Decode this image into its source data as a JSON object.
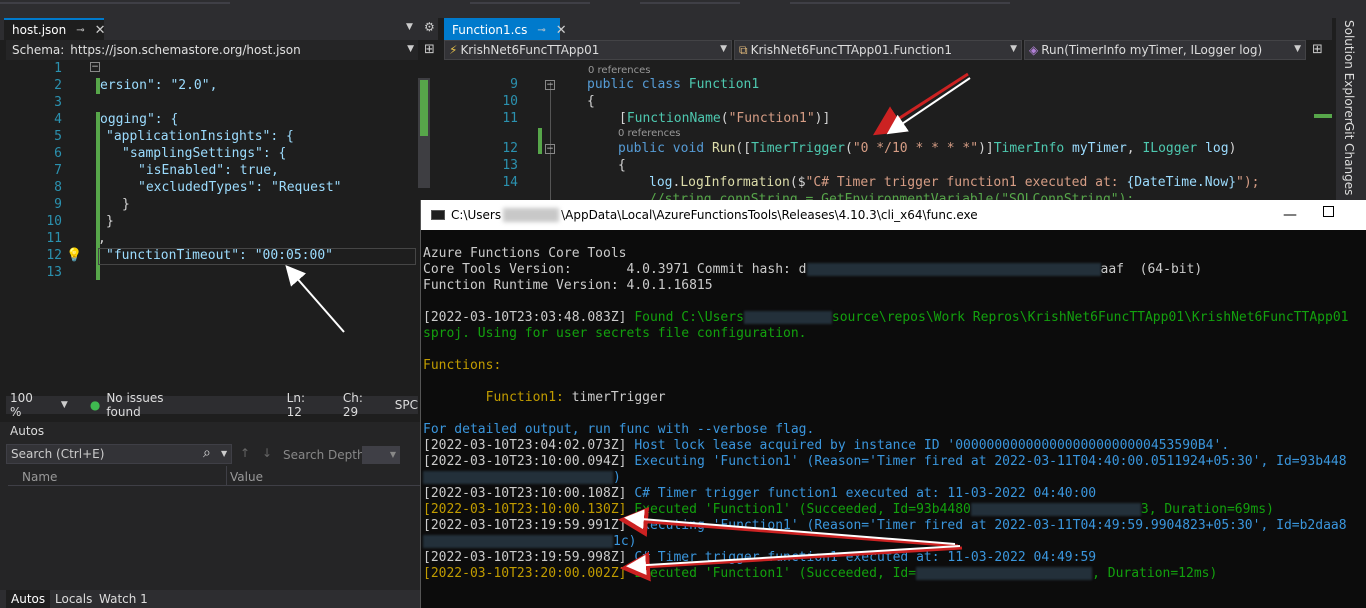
{
  "left_editor": {
    "tab_title": "host.json",
    "schema_label": "Schema:",
    "schema_url": "https://json.schemastore.org/host.json",
    "lines": [
      {
        "n": "1",
        "text": ""
      },
      {
        "n": "2",
        "text": "ersion\": \"2.0\","
      },
      {
        "n": "3",
        "text": ""
      },
      {
        "n": "4",
        "text": "ogging\": {"
      },
      {
        "n": "5",
        "text": "\"applicationInsights\": {"
      },
      {
        "n": "6",
        "text": "\"samplingSettings\": {"
      },
      {
        "n": "7",
        "text": "\"isEnabled\": true,"
      },
      {
        "n": "8",
        "text": "\"excludedTypes\": \"Request\""
      },
      {
        "n": "9",
        "text": "}"
      },
      {
        "n": "10",
        "text": "}"
      },
      {
        "n": "11",
        "text": ","
      },
      {
        "n": "12",
        "text": "\"functionTimeout\": \"00:05:00\""
      },
      {
        "n": "13",
        "text": ""
      }
    ],
    "status": {
      "zoom": "100 %",
      "issues": "No issues found",
      "ln": "Ln: 12",
      "ch": "Ch: 29",
      "enc": "SPC"
    }
  },
  "autos": {
    "title": "Autos",
    "search_placeholder": "Search (Ctrl+E)",
    "search_depth": "Search Depth:",
    "col_name": "Name",
    "col_value": "Value",
    "tabs": [
      "Autos",
      "Locals",
      "Watch 1"
    ]
  },
  "right_editor": {
    "tab_title": "Function1.cs",
    "nav": [
      "KrishNet6FuncTTApp01",
      "KrishNet6FuncTTApp01.Function1",
      "Run(TimerInfo myTimer, ILogger log)"
    ],
    "refs1": "0 references",
    "refs2": "0 references",
    "line_numbers": [
      "9",
      "10",
      "11",
      "12",
      "13",
      "14"
    ],
    "l9": {
      "kw1": "public",
      "kw2": "class",
      "name": "Function1"
    },
    "l10": "{",
    "l11": {
      "pre": "[",
      "attr": "FunctionName",
      "open": "(",
      "str": "\"Function1\"",
      "close": ")]"
    },
    "l12": {
      "kw1": "public",
      "kw2": "void",
      "meth": "Run",
      "p1": "([",
      "attr": "TimerTrigger",
      "p2": "(",
      "str": "\"0 */10 * * * *\"",
      "p3": ")]",
      "t1": "TimerInfo",
      "a1": "myTimer",
      "p4": ", ",
      "t2": "ILogger",
      "a2": "log",
      "p5": ")"
    },
    "l13": "{",
    "l14": {
      "id": "log",
      "dot": ".",
      "meth": "LogInformation",
      "p1": "($",
      "str": "\"C# Timer trigger function1 executed at: ",
      "inter": "{DateTime.Now}",
      "end": "\");"
    },
    "l15": "//string connString = GetEnvironmentVariable(\"SQLConnString\");"
  },
  "side_strip": {
    "solution_explorer": "Solution Explorer",
    "git_changes": "Git Changes"
  },
  "console": {
    "title_prefix": "C:\\Users",
    "title_suffix": "\\AppData\\Local\\AzureFunctionsTools\\Releases\\4.10.3\\cli_x64\\func.exe",
    "lines": {
      "l1": "Azure Functions Core Tools",
      "l2a": "Core Tools Version:       4.0.3971 Commit hash: d",
      "l2b": "aaf  (64-bit)",
      "l3": "Function Runtime Version: 4.0.1.16815",
      "l4_ts": "[2022-03-10T23:03:48.083Z]",
      "l4a": " Found C:\\Users",
      "l4b": "source\\repos\\Work Repros\\KrishNet6FuncTTApp01\\KrishNet6FuncTTApp01",
      "l5": "sproj. Using for user secrets file configuration.",
      "l6": "Functions:",
      "l7a": "        Function1:",
      "l7b": " timerTrigger",
      "l8": "For detailed output, run func with --verbose flag.",
      "l9_ts": "[2022-03-10T23:04:02.073Z]",
      "l9": " Host lock lease acquired by instance ID '0000000000000000000000000453590B4'.",
      "l10_ts": "[2022-03-10T23:10:00.094Z]",
      "l10": " Executing 'Function1' (Reason='Timer fired at 2022-03-11T04:40:00.0511924+05:30', Id=93b448",
      "l11": ")",
      "l12_ts": "[2022-03-10T23:10:00.108Z]",
      "l12": " C# Timer trigger function1 executed at: 11-03-2022 04:40:00",
      "l13_ts": "[2022-03-10T23:10:00.130Z]",
      "l13a": " Executed 'Function1' (Succeeded, Id=93b4480",
      "l13b": "3, Duration=69ms)",
      "l14_ts": "[2022-03-10T23:19:59.991Z]",
      "l14": " Executing 'Function1' (Reason='Timer fired at 2022-03-11T04:49:59.9904823+05:30', Id=b2daa8",
      "l15": "1c)",
      "l16_ts": "[2022-03-10T23:19:59.998Z]",
      "l16": " C# Timer trigger function1 executed at: 11-03-2022 04:49:59",
      "l17_ts": "[2022-03-10T23:20:00.002Z]",
      "l17a": " Executed 'Function1' (Succeeded, Id=",
      "l17b": ", Duration=12ms)"
    }
  },
  "colors": {
    "accent": "#007acc",
    "green": "#13a10e",
    "yellow": "#c19c00",
    "blue": "#3a96dd",
    "annotation": "#ffffff",
    "annotation_red": "#cc2222"
  }
}
